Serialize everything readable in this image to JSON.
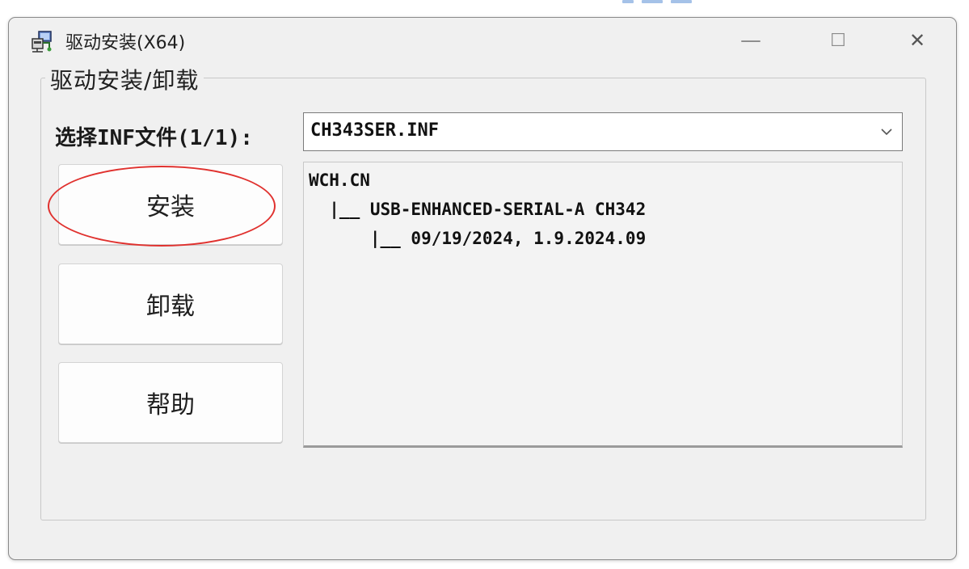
{
  "window": {
    "title": "驱动安装(X64)",
    "controls": {
      "minimize": "—",
      "maximize": "☐",
      "close": "✕"
    }
  },
  "group": {
    "title": "驱动安装/卸载"
  },
  "inf": {
    "label": "选择INF文件(1/1):",
    "selected": "CH343SER.INF"
  },
  "buttons": {
    "install": "安装",
    "uninstall": "卸载",
    "help": "帮助"
  },
  "info": {
    "lines": [
      "WCH.CN",
      "  |__ USB-ENHANCED-SERIAL-A CH342",
      "      |__ 09/19/2024, 1.9.2024.09"
    ]
  },
  "icons": {
    "app": "installer-icon",
    "dropdown": "chevron-down-icon"
  },
  "colors": {
    "highlight": "#e0312e",
    "window_bg": "#f0f0f0"
  }
}
